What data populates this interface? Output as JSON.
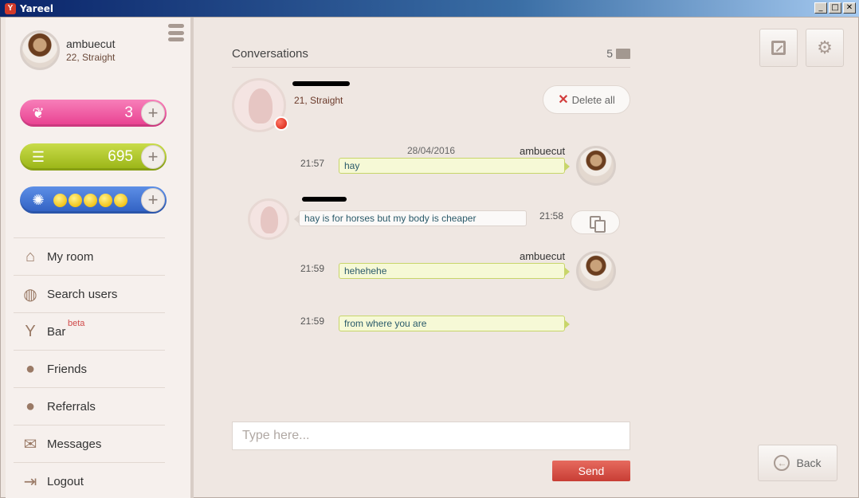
{
  "window": {
    "title": "Yareel",
    "minimize": "_",
    "maximize": "□",
    "close": "✕"
  },
  "profile": {
    "name": "ambuecut",
    "sub": "22, Straight"
  },
  "stats": {
    "strawberries": "3",
    "coins": "695",
    "plus": "+"
  },
  "nav": {
    "my_room": "My room",
    "search_users": "Search users",
    "bar": "Bar",
    "beta": "beta",
    "friends": "Friends",
    "referrals": "Referrals",
    "messages": "Messages",
    "logout": "Logout"
  },
  "conversation": {
    "title": "Conversations",
    "count": "5",
    "contact_sub": "21, Straight",
    "delete_all": "Delete all",
    "messages": [
      {
        "date": "28/04/2016",
        "sender": "ambuecut",
        "time": "21:57",
        "text": "hay"
      },
      {
        "time": "21:58",
        "text": "hay is for horses but my body is cheaper"
      },
      {
        "sender": "ambuecut",
        "time": "21:59",
        "text": "hehehehe"
      },
      {
        "time": "21:59",
        "text": "from where you are"
      }
    ]
  },
  "composer": {
    "placeholder": "Type here...",
    "send": "Send"
  },
  "controls": {
    "back": "Back"
  },
  "colors": {
    "send": "#d2473d",
    "online": "#d41a0a",
    "pink": "#e83e8f",
    "green": "#98b314",
    "blue": "#2f5fc1"
  }
}
